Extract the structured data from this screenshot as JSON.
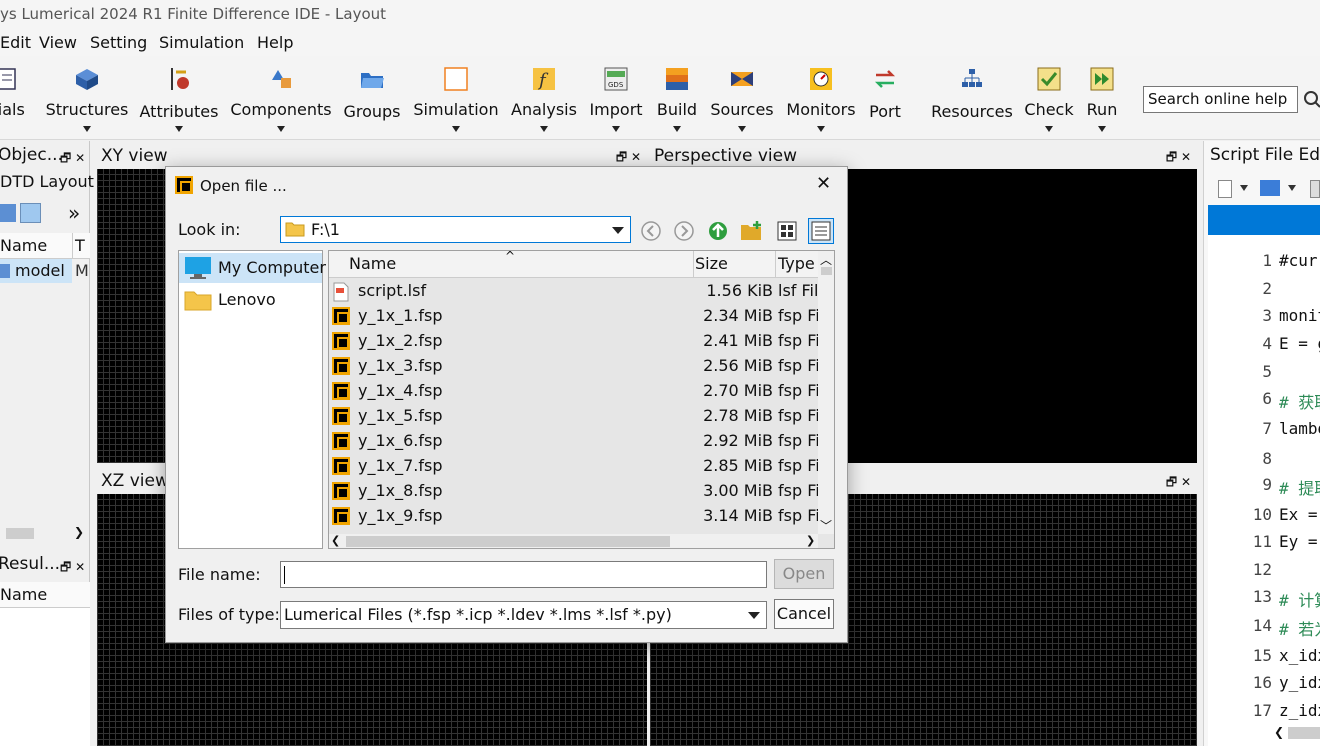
{
  "app": {
    "title": "ys Lumerical 2024 R1 Finite Difference IDE - Layout"
  },
  "menu": [
    "Edit",
    "View",
    "Setting",
    "Simulation",
    "Help"
  ],
  "toolbar": {
    "items": [
      "rials",
      "Structures",
      "Attributes",
      "Components",
      "Groups",
      "Simulation",
      "Analysis",
      "Import",
      "Build",
      "Sources",
      "Monitors",
      "Port",
      "Resources",
      "Check",
      "Run"
    ],
    "search_placeholder": "Search online help"
  },
  "panels": {
    "objects_title": "Objec...",
    "fdtd_layout": "DTD Layout",
    "name_col": "Name",
    "type_col": "T",
    "tree_item": "model",
    "tree_item_type": "M",
    "results_title": "Resul...",
    "results_name_col": "Name",
    "expand": "»"
  },
  "views": {
    "xy": "XY view",
    "xz": "XZ view",
    "perspective": "Perspective view"
  },
  "script_editor": {
    "title": "Script File Ed",
    "line_numbers": [
      "1",
      "2",
      "3",
      "4",
      "5",
      "6",
      "7",
      "8",
      "9",
      "10",
      "11",
      "12",
      "13",
      "14",
      "15",
      "16",
      "17"
    ],
    "lines": [
      "#curr",
      "",
      "monit",
      "E = g",
      "",
      "# 获取",
      "lambd",
      "",
      "# 提取",
      "Ex =",
      "Ey =",
      "",
      "# 计算",
      "# 若为",
      "x_idx",
      "y_idx",
      "z_idx"
    ]
  },
  "dialog": {
    "title": "Open file ...",
    "look_in_label": "Look in:",
    "look_in_value": "F:\\1",
    "places": [
      "My Computer",
      "Lenovo"
    ],
    "columns": {
      "name": "Name",
      "size": "Size",
      "type": "Type"
    },
    "files": [
      {
        "name": "script.lsf",
        "size": "1.56 KiB",
        "type": "lsf Fil"
      },
      {
        "name": "y_1x_1.fsp",
        "size": "2.34 MiB",
        "type": "fsp Fi"
      },
      {
        "name": "y_1x_2.fsp",
        "size": "2.41 MiB",
        "type": "fsp Fi"
      },
      {
        "name": "y_1x_3.fsp",
        "size": "2.56 MiB",
        "type": "fsp Fi"
      },
      {
        "name": "y_1x_4.fsp",
        "size": "2.70 MiB",
        "type": "fsp Fi"
      },
      {
        "name": "y_1x_5.fsp",
        "size": "2.78 MiB",
        "type": "fsp Fi"
      },
      {
        "name": "y_1x_6.fsp",
        "size": "2.92 MiB",
        "type": "fsp Fi"
      },
      {
        "name": "y_1x_7.fsp",
        "size": "2.85 MiB",
        "type": "fsp Fi"
      },
      {
        "name": "y_1x_8.fsp",
        "size": "3.00 MiB",
        "type": "fsp Fi"
      },
      {
        "name": "y_1x_9.fsp",
        "size": "3.14 MiB",
        "type": "fsp Fi"
      }
    ],
    "file_name_label": "File name:",
    "file_name_value": "",
    "open_button": "Open",
    "files_of_type_label": "Files of type:",
    "files_of_type_value": "Lumerical Files (*.fsp *.icp *.ldev *.lms *.lsf *.py)",
    "cancel_button": "Cancel"
  },
  "colors": {
    "accent": "#0078d7",
    "fsp_icon": "#f0a400",
    "selection": "#cce4f7"
  }
}
